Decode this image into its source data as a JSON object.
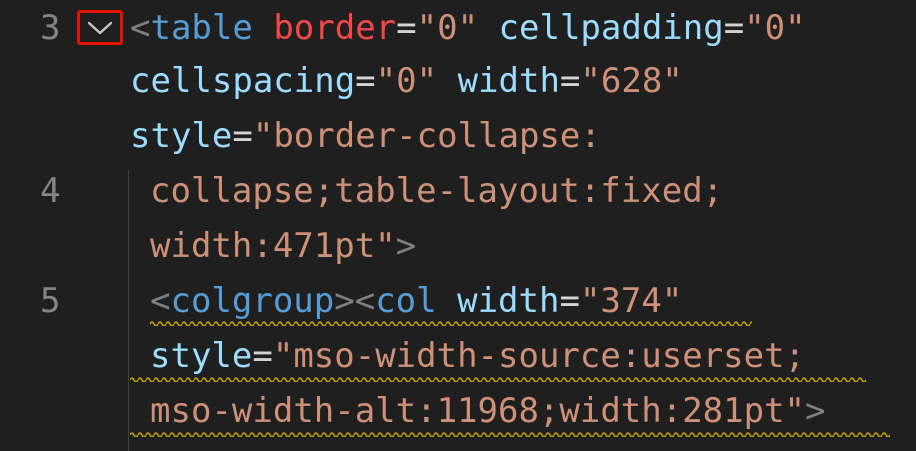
{
  "editor": {
    "fold_icon": "chevron-down-icon",
    "lines": [
      {
        "number": "3",
        "segments": [
          {
            "text": "<",
            "kind": "punct"
          },
          {
            "text": "table",
            "kind": "tag"
          },
          {
            "text": " ",
            "kind": "plain"
          },
          {
            "text": "border",
            "kind": "attr-red"
          },
          {
            "text": "=",
            "kind": "eq"
          },
          {
            "text": "\"0\"",
            "kind": "str"
          },
          {
            "text": " ",
            "kind": "plain"
          },
          {
            "text": "cellpadding",
            "kind": "attr"
          },
          {
            "text": "=",
            "kind": "eq"
          },
          {
            "text": "\"0\"",
            "kind": "str"
          }
        ]
      },
      {
        "number": "",
        "segments": [
          {
            "text": "cellspacing",
            "kind": "attr"
          },
          {
            "text": "=",
            "kind": "eq"
          },
          {
            "text": "\"0\"",
            "kind": "str"
          },
          {
            "text": " ",
            "kind": "plain"
          },
          {
            "text": "width",
            "kind": "attr"
          },
          {
            "text": "=",
            "kind": "eq"
          },
          {
            "text": "\"628\"",
            "kind": "str"
          }
        ]
      },
      {
        "number": "",
        "segments": [
          {
            "text": "style",
            "kind": "attr"
          },
          {
            "text": "=",
            "kind": "eq"
          },
          {
            "text": "\"border-collapse:",
            "kind": "str"
          }
        ]
      },
      {
        "number": "4",
        "segments": [
          {
            "text": "collapse;table-layout:fixed;",
            "kind": "str"
          }
        ]
      },
      {
        "number": "",
        "segments": [
          {
            "text": "width:471pt\"",
            "kind": "str"
          },
          {
            "text": ">",
            "kind": "punct"
          }
        ]
      },
      {
        "number": "5",
        "segments": [
          {
            "text": "<",
            "kind": "punct"
          },
          {
            "text": "colgroup",
            "kind": "tag"
          },
          {
            "text": "><",
            "kind": "punct"
          },
          {
            "text": "col",
            "kind": "tag"
          },
          {
            "text": " ",
            "kind": "plain"
          },
          {
            "text": "width",
            "kind": "attr"
          },
          {
            "text": "=",
            "kind": "eq"
          },
          {
            "text": "\"374\"",
            "kind": "str"
          }
        ]
      },
      {
        "number": "",
        "segments": [
          {
            "text": "style",
            "kind": "attr"
          },
          {
            "text": "=",
            "kind": "eq"
          },
          {
            "text": "\"mso-width-source:userset;",
            "kind": "str"
          }
        ]
      },
      {
        "number": "",
        "segments": [
          {
            "text": "mso-width-alt:11968;width:281pt\"",
            "kind": "str"
          },
          {
            "text": ">",
            "kind": "punct"
          }
        ]
      }
    ]
  }
}
